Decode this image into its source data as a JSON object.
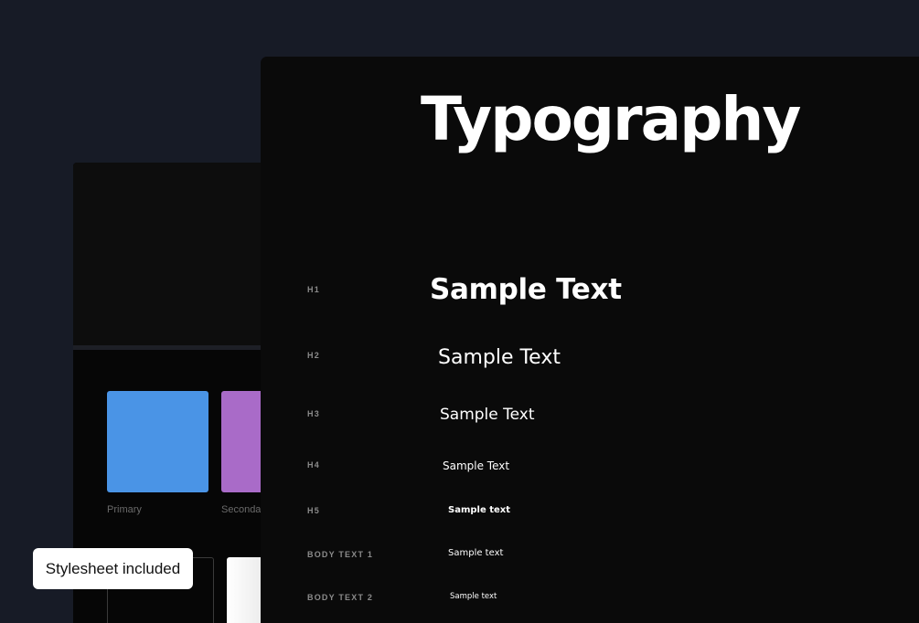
{
  "colors": {
    "background": "#171b26",
    "panel": "#0a0a0a",
    "primary": "#4a94e6",
    "secondary": "#a96bc8"
  },
  "palette": {
    "primary_label": "Primary",
    "secondary_label": "Seconda"
  },
  "typography": {
    "title": "Typography",
    "rows": [
      {
        "label": "H1",
        "sample": "Sample Text"
      },
      {
        "label": "H2",
        "sample": "Sample Text"
      },
      {
        "label": "H3",
        "sample": "Sample Text"
      },
      {
        "label": "H4",
        "sample": "Sample Text"
      },
      {
        "label": "H5",
        "sample": "Sample text"
      },
      {
        "label": "BODY TEXT 1",
        "sample": "Sample text"
      },
      {
        "label": "BODY TEXT 2",
        "sample": "Sample text"
      }
    ]
  },
  "badge": {
    "label": "Stylesheet included"
  }
}
